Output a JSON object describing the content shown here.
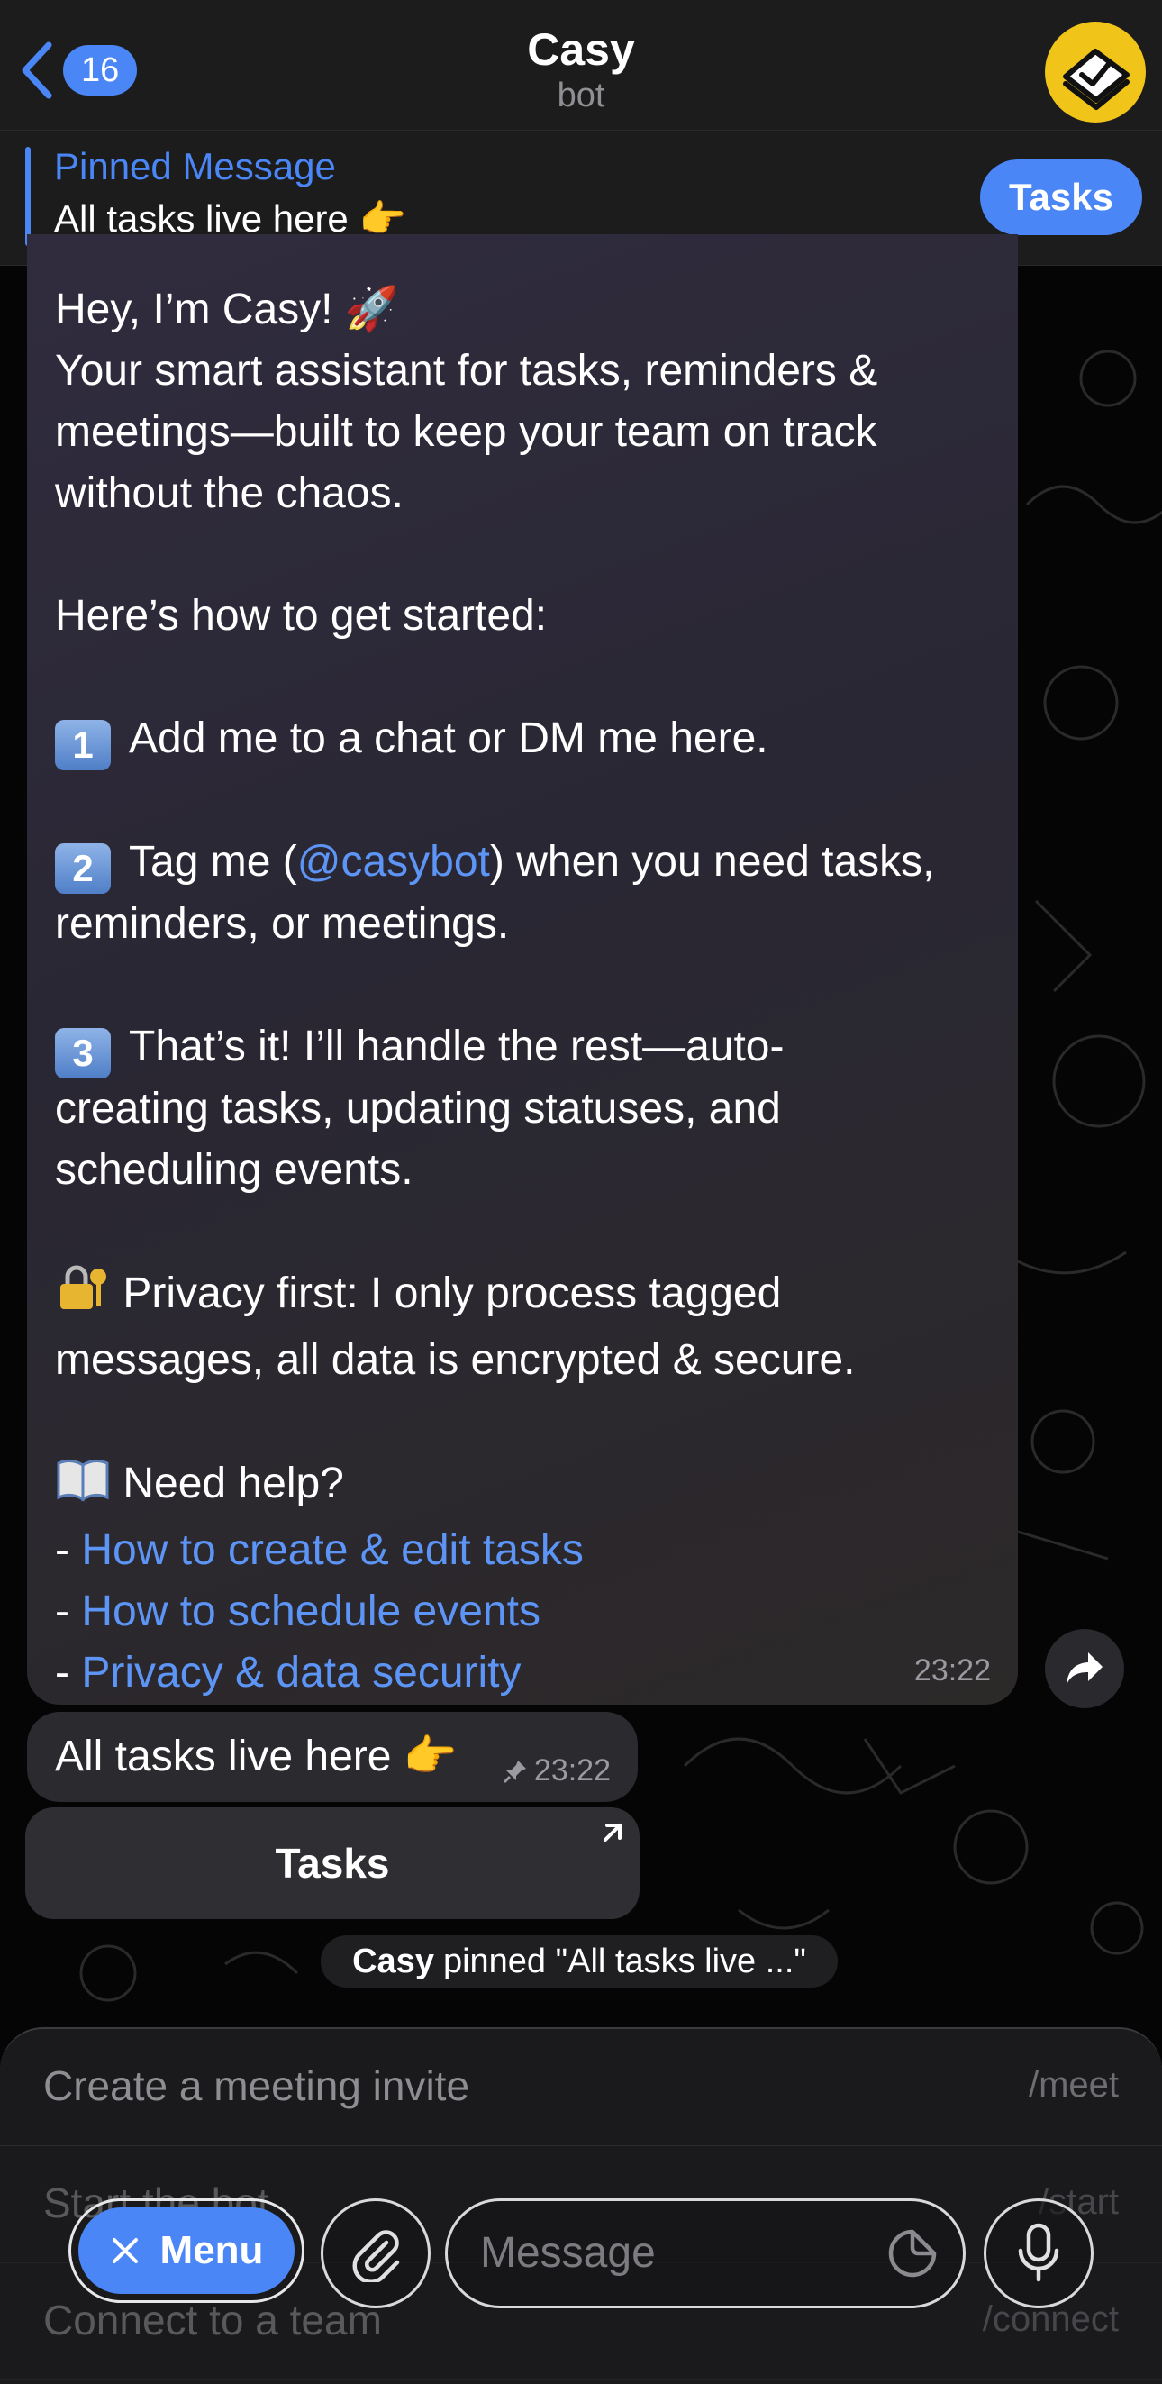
{
  "header": {
    "back_count": "16",
    "title": "Casy",
    "subtitle": "bot"
  },
  "pinned": {
    "title": "Pinned Message",
    "text": "All tasks live here 👉",
    "button_label": "Tasks"
  },
  "message": {
    "lines": [
      "Hey, I’m Casy! 🚀",
      "Your smart assistant for tasks, reminders &",
      "meetings—built to keep your team on track",
      "without the chaos.",
      "Here’s how to get started:",
      "Add me to a chat or DM me here.",
      "Tag me (",
      "@casybot",
      ") when you need tasks,",
      "reminders, or meetings.",
      "That’s it! I’ll handle the rest—auto-",
      "creating tasks, updating statuses, and",
      "scheduling events.",
      "Privacy first: I only process tagged",
      "messages, all data is encrypted & secure.",
      "Need help?"
    ],
    "step_numbers": [
      "1",
      "2",
      "3"
    ],
    "help_links": [
      "How to create & edit tasks",
      "How to schedule events",
      "Privacy & data security"
    ],
    "link_prefix": "- ",
    "time": "23:22"
  },
  "pinned_message": {
    "text": "All tasks live here 👉",
    "time": "23:22"
  },
  "inline_button": {
    "label": "Tasks"
  },
  "service_message": {
    "actor": "Casy",
    "text": "pinned \"All tasks live ...\""
  },
  "commands": [
    {
      "label": "Create a meeting invite",
      "code": "/meet"
    },
    {
      "label": "Start the bot",
      "code": "/start"
    },
    {
      "label": "Connect to a team",
      "code": "/connect"
    }
  ],
  "input": {
    "menu_label": "Menu",
    "placeholder": "Message"
  },
  "colors": {
    "accent": "#4a86f5",
    "link": "#5d95f7",
    "avatar": "#f0c419"
  }
}
